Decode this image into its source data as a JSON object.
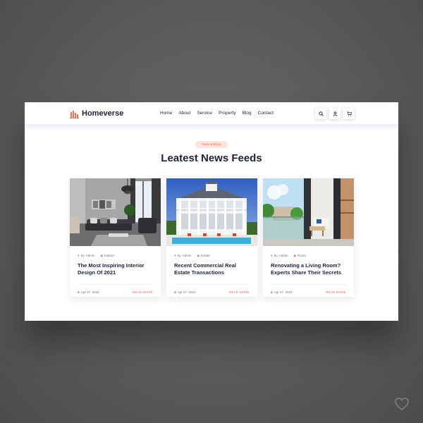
{
  "brand": {
    "name": "Homeverse",
    "accent": "#f26d56",
    "dark": "#1c2333"
  },
  "nav": {
    "items": [
      "Home",
      "About",
      "Service",
      "Property",
      "Blog",
      "Contact"
    ]
  },
  "header_actions": [
    {
      "icon": "search-icon"
    },
    {
      "icon": "user-icon"
    },
    {
      "icon": "cart-icon"
    }
  ],
  "section": {
    "badge": "News & Blogs",
    "title": "Leatest News Feeds"
  },
  "cards": [
    {
      "author": "by: Admin",
      "category": "Interior",
      "title": "The Most Inspiring Interior Design Of 2021",
      "date": "Apr 27, 2022",
      "link": "READ MORE"
    },
    {
      "author": "by: Admin",
      "category": "Estate",
      "title": "Recent Commercial Real Estate Transactions",
      "date": "Apr 27, 2022",
      "link": "READ MORE"
    },
    {
      "author": "by: Admin",
      "category": "Room",
      "title": "Renovating a Living Room? Experts Share Their Secrets",
      "date": "Apr 27, 2022",
      "link": "READ MORE"
    }
  ],
  "corner": {
    "icon": "heart-icon"
  }
}
